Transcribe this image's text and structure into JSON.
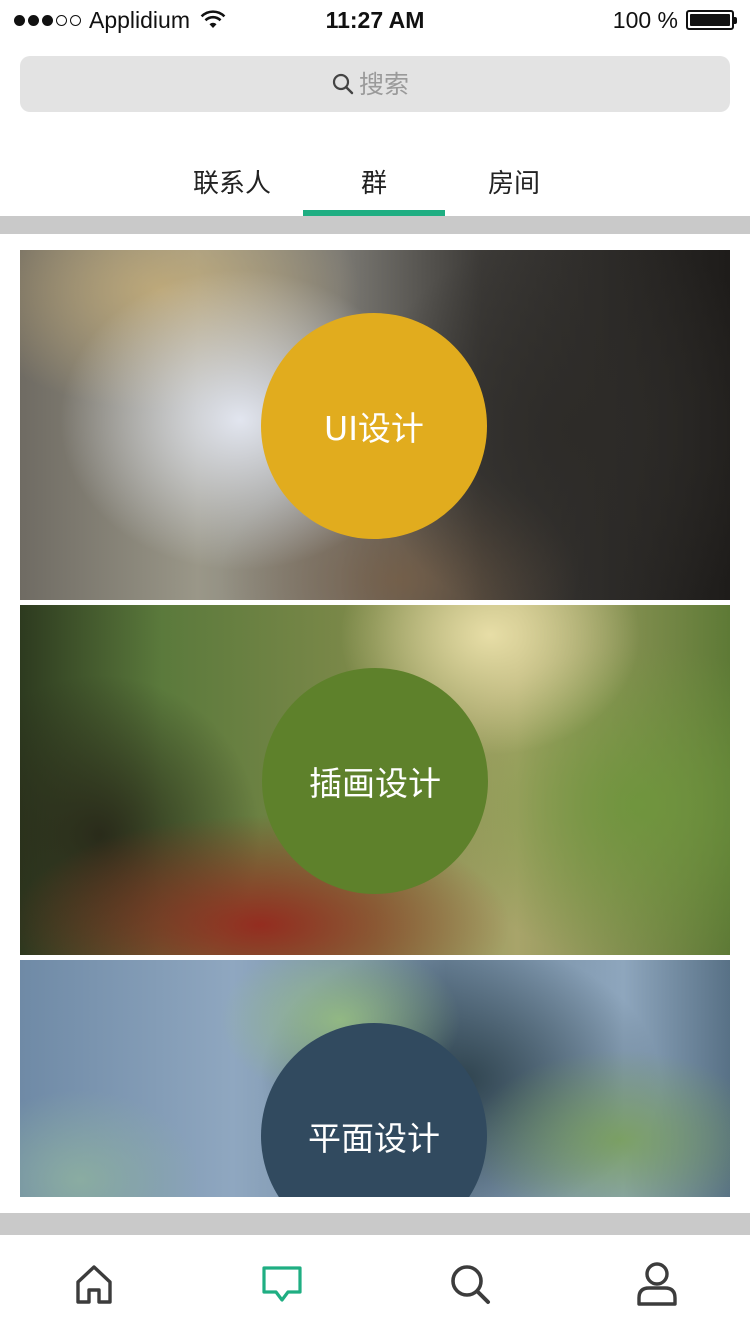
{
  "status_bar": {
    "carrier": "Applidium",
    "time": "11:27 AM",
    "battery": "100 %"
  },
  "search": {
    "placeholder": "搜索"
  },
  "tabs": [
    {
      "label": "联系人",
      "active": false
    },
    {
      "label": "群",
      "active": true
    },
    {
      "label": "房间",
      "active": false
    }
  ],
  "groups": [
    {
      "name": "UI设计",
      "color": "#e1ac1e"
    },
    {
      "name": "插画设计",
      "color": "#5e812b"
    },
    {
      "name": "平面设计",
      "color": "#314a5f"
    }
  ],
  "accent_color": "#1fae82",
  "bottom_nav": {
    "items": [
      {
        "icon": "home-icon",
        "active": false
      },
      {
        "icon": "message-icon",
        "active": true
      },
      {
        "icon": "search-icon",
        "active": false
      },
      {
        "icon": "profile-icon",
        "active": false
      }
    ]
  }
}
